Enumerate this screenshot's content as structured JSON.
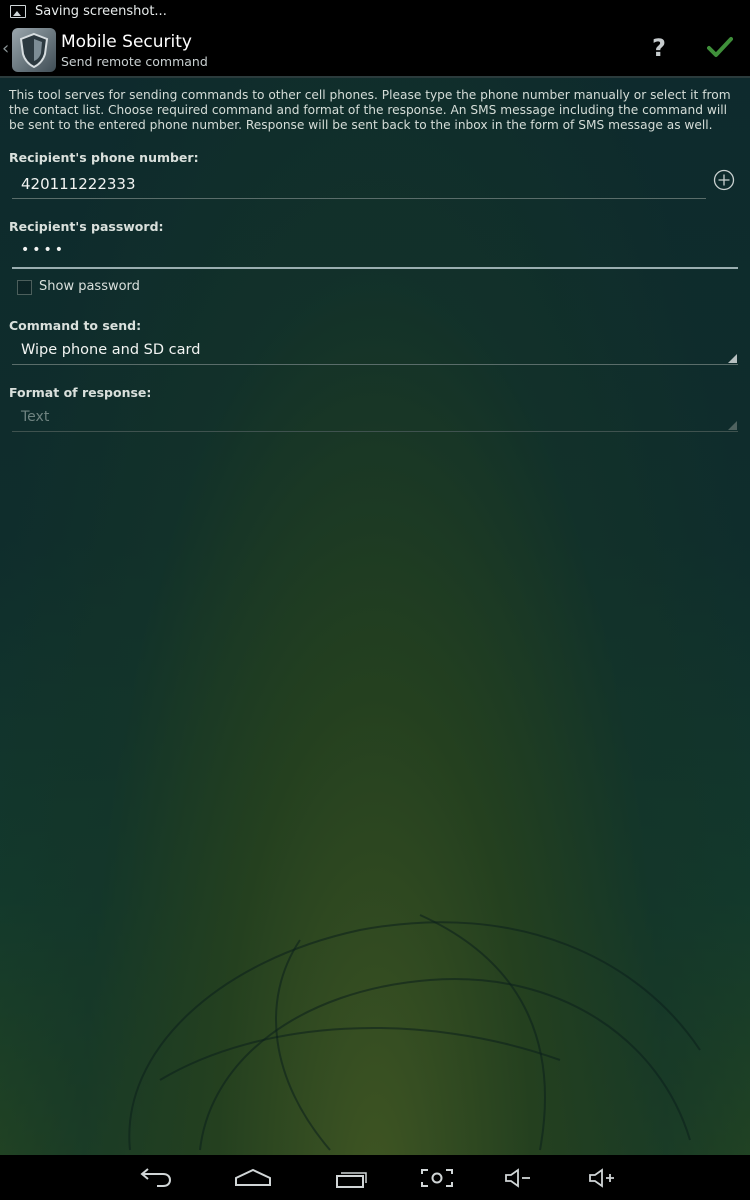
{
  "status_bar": {
    "notification": "Saving screenshot..."
  },
  "action_bar": {
    "title": "Mobile Security",
    "subtitle": "Send remote command",
    "help_label": "?"
  },
  "intro_text": "This tool serves for sending commands to other cell phones. Please type the phone number manually or select it from the contact list. Choose required command and format of the response. An SMS message including the command will be sent to the entered phone number. Response will be sent back to the inbox in the form of SMS message as well.",
  "phone": {
    "label": "Recipient's phone number:",
    "value": "420111222333"
  },
  "password": {
    "label": "Recipient's password:",
    "masked_value": "••••",
    "show_password_label": "Show password",
    "show_password_checked": false
  },
  "command": {
    "label": "Command to send:",
    "selected": "Wipe phone and SD card"
  },
  "response_format": {
    "label": "Format of response:",
    "selected": "Text",
    "enabled": false
  },
  "nav_bar": {
    "icons": [
      "back-icon",
      "home-icon",
      "recent-apps-icon",
      "screenshot-icon",
      "volume-down-icon",
      "volume-up-icon"
    ]
  },
  "colors": {
    "accent_check": "#3f8f3a",
    "background_top": "#0e2a2d",
    "background_bottom": "#274820"
  }
}
